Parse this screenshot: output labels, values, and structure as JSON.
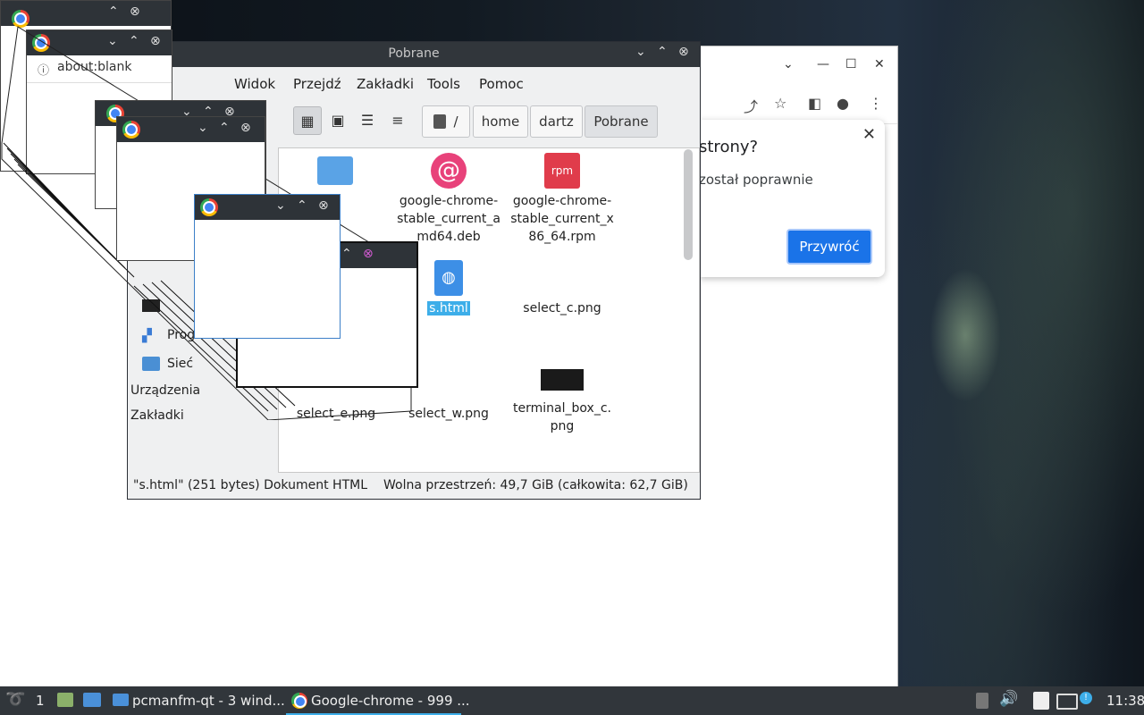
{
  "chrome": {
    "address": "about:blank",
    "dialog_title": "strony?",
    "dialog_body": "został poprawnie",
    "restore_label": "Przywróć",
    "close_glyph": "✕"
  },
  "file_manager": {
    "title": "Pobrane",
    "menu": [
      "Widok",
      "Przejdź",
      "Zakładki",
      "Tools",
      "Pomoc"
    ],
    "breadcrumbs": [
      "/",
      "home",
      "dartz",
      "Pobrane"
    ],
    "files": [
      {
        "name": "google-chrome-stable_current_amd64.deb",
        "icon": "debian-package-icon"
      },
      {
        "name": "google-chrome-stable_current_x86_64.rpm",
        "icon": "rpm-package-icon"
      },
      {
        "name": "s.html",
        "icon": "html-file-icon",
        "selected": true
      },
      {
        "name": "select_c.png",
        "icon": "image-file-icon"
      },
      {
        "name": "select_e.png",
        "icon": "image-file-icon"
      },
      {
        "name": "select_w.png",
        "icon": "image-file-icon"
      },
      {
        "name": "terminal_box_c.png",
        "icon": "black-image-thumbnail-icon"
      }
    ],
    "file_labels": {
      "deb": "google-chrome-\nstable_current_a\nmd64.deb",
      "rpm": "google-chrome-\nstable_current_x\n86_64.rpm",
      "html": "s.html",
      "select_c": "select_c.png",
      "select_e": "select_e.png",
      "select_w": "select_w.png",
      "terminal": "terminal_box_c.\npng"
    },
    "sidebar": {
      "items": [
        "Prog",
        "Sieć"
      ],
      "headers": [
        "Urządzenia",
        "Zakładki"
      ]
    },
    "status_left": "\"s.html\" (251 bytes) Dokument HTML",
    "status_right": "Wolna przestrzeń: 49,7 GiB (całkowita: 62,7 GiB)"
  },
  "taskbar": {
    "workspace": "1",
    "task1": "pcmanfm-qt - 3 wind...",
    "task2": "Google-chrome - 999 ...",
    "clock": "11:38"
  },
  "colors": {
    "accent": "#3daee9",
    "chrome_blue": "#1a73e8",
    "titlebar": "#31363b"
  }
}
